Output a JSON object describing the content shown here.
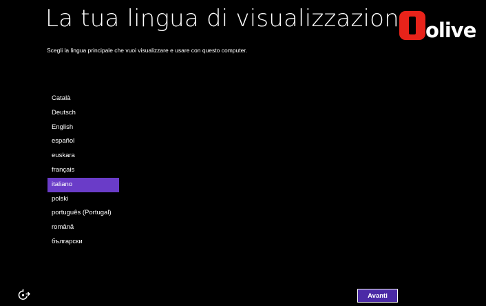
{
  "header": {
    "title": "La tua lingua di visualizzazione",
    "subtitle": "Scegli la lingua principale che vuoi visualizzare e usare con questo computer."
  },
  "logo": {
    "text": "olive",
    "accent_color": "#e8231a"
  },
  "languages": {
    "items": [
      "Català",
      "Deutsch",
      "English",
      "español",
      "euskara",
      "français",
      "italiano",
      "polski",
      "português (Portugal)",
      "română",
      "български"
    ],
    "selected": "italiano",
    "selected_color": "#6a3cc8"
  },
  "footer": {
    "accessibility_icon": "ease-of-access-icon",
    "next_label": "Avanti"
  }
}
